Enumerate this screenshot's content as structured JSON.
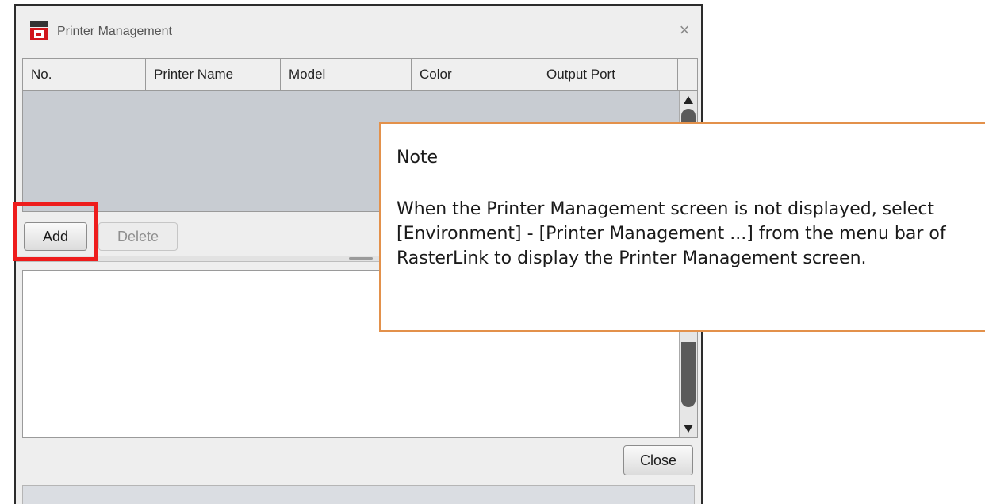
{
  "window": {
    "title": "Printer Management",
    "close_glyph": "×"
  },
  "table": {
    "columns": [
      "No.",
      "Printer Name",
      "Model",
      "Color",
      "Output Port"
    ],
    "rows": []
  },
  "buttons": {
    "add": "Add",
    "delete": "Delete",
    "close": "Close"
  },
  "note": {
    "title": "Note",
    "body": "When the Printer Management screen is not displayed, select [Environment] - [Printer Management ...] from the menu bar of RasterLink to display the Printer Management screen."
  },
  "colors": {
    "highlight": "#ee1c1c",
    "note_border": "#e3914b"
  },
  "icons": {
    "app": "app-icon",
    "close": "close-icon",
    "scroll_up": "arrow-up-icon",
    "scroll_down": "arrow-down-icon"
  }
}
